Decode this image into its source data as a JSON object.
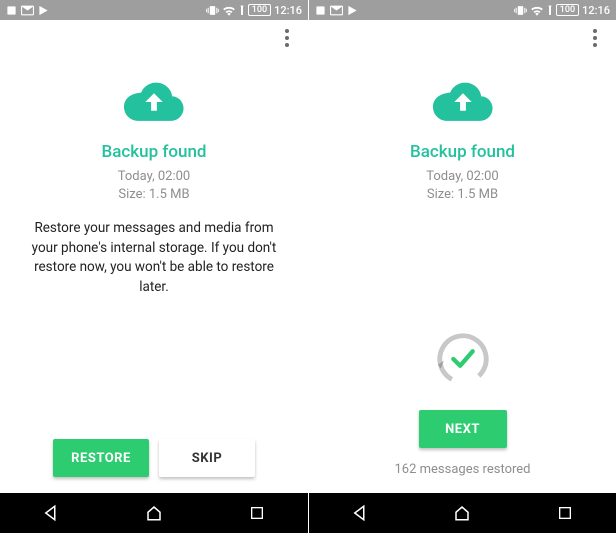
{
  "status": {
    "time": "12:16",
    "battery": "100"
  },
  "left": {
    "title": "Backup found",
    "when": "Today, 02:00",
    "size": "Size: 1.5 MB",
    "description": "Restore your messages and media from your phone's internal storage. If you don't restore now, you won't be able to restore later.",
    "restore_label": "RESTORE",
    "skip_label": "SKIP"
  },
  "right": {
    "title": "Backup found",
    "when": "Today, 02:00",
    "size": "Size: 1.5 MB",
    "next_label": "NEXT",
    "restored_text": "162 messages restored"
  }
}
